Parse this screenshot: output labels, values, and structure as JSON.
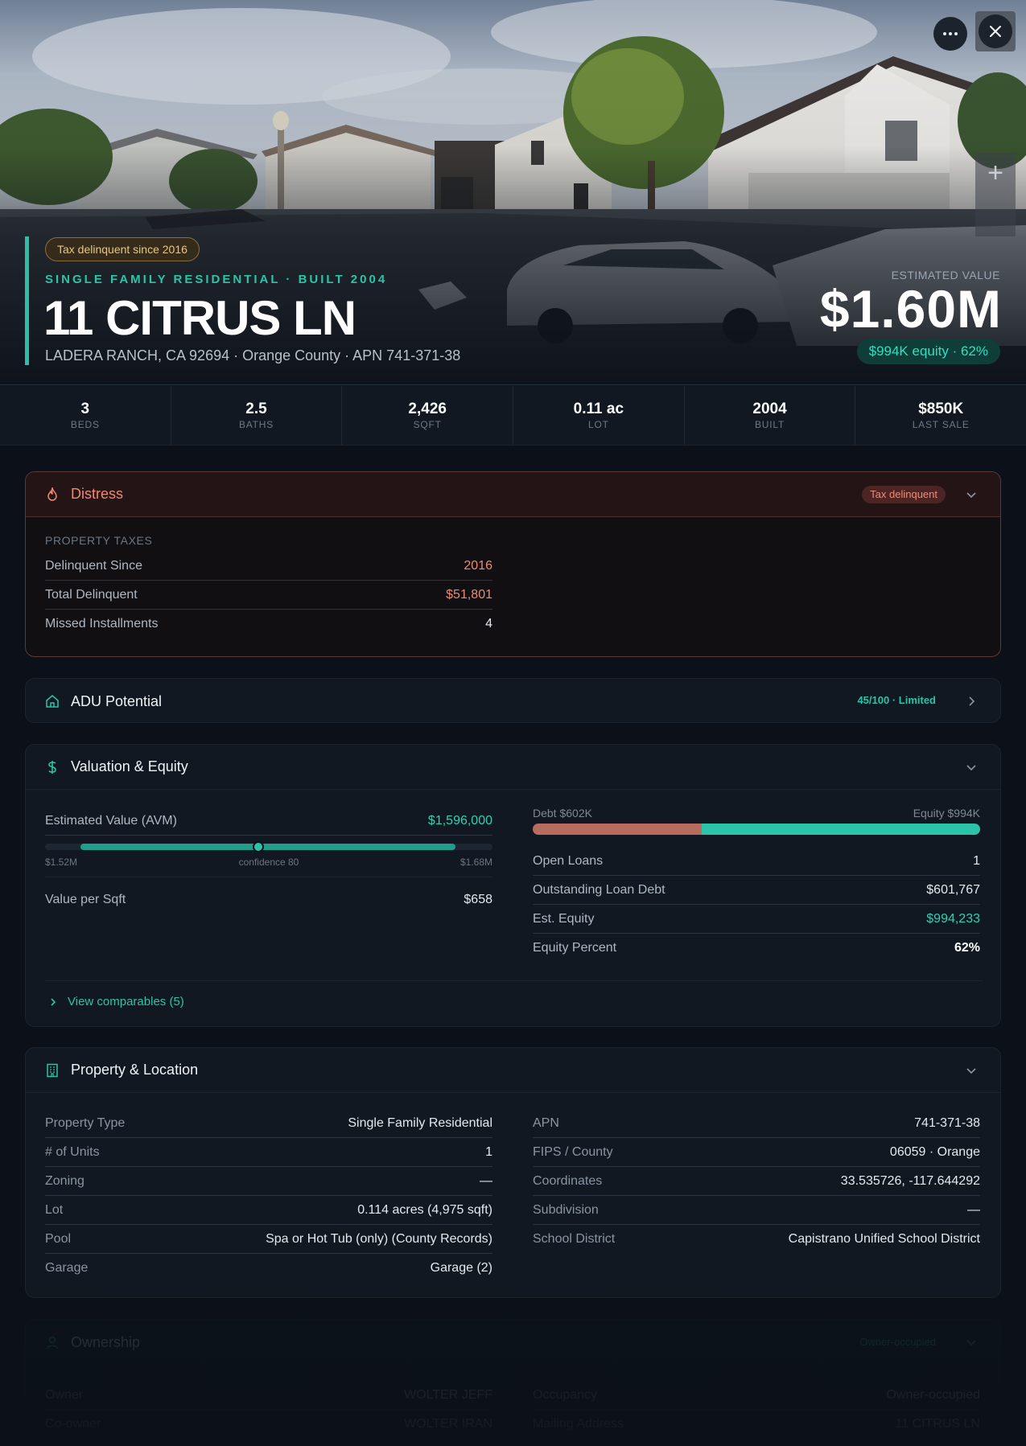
{
  "hero": {
    "tax_pill": "Tax delinquent since 2016",
    "subtitle": "SINGLE FAMILY RESIDENTIAL · BUILT 2004",
    "title": "11 CITRUS LN",
    "address": "LADERA RANCH, CA 92694 · Orange County · APN 741-371-38",
    "estimated_label": "ESTIMATED VALUE",
    "estimated_value": "$1.60M",
    "equity_pill": "$994K equity · 62%",
    "buttons": {
      "more_icon": "more-horizontal-icon",
      "close_icon": "close-icon",
      "zoom_icon": "plus-icon"
    }
  },
  "stats": [
    {
      "value": "3",
      "label": "BEDS"
    },
    {
      "value": "2.5",
      "label": "BATHS"
    },
    {
      "value": "2,426",
      "label": "SQFT"
    },
    {
      "value": "0.11 ac",
      "label": "LOT"
    },
    {
      "value": "2004",
      "label": "BUILT"
    },
    {
      "value": "$850K",
      "label": "LAST SALE"
    }
  ],
  "distress": {
    "title": "Distress",
    "icon": "flame-icon",
    "badge": "Tax delinquent",
    "section_label": "PROPERTY TAXES",
    "rows": [
      {
        "label": "Delinquent Since",
        "value": "2016"
      },
      {
        "label": "Total Delinquent",
        "value": "$51,801"
      },
      {
        "label": "Missed Installments",
        "value": "4"
      }
    ]
  },
  "adu": {
    "title": "ADU Potential",
    "icon": "home-icon",
    "badge": "45/100 · Limited"
  },
  "valuation": {
    "title": "Valuation & Equity",
    "icon": "dollar-icon",
    "avm_label": "Estimated Value (AVM)",
    "avm_value": "$1,596,000",
    "range_low": "$1.52M",
    "range_mid": "confidence 80",
    "range_high": "$1.68M",
    "range_low_num": 1.52,
    "range_high_num": 1.68,
    "avm_num": 1.596,
    "value_per_sqft_label": "Value per Sqft",
    "value_per_sqft": "$658",
    "debt_label": "Debt $602K",
    "equity_label": "Equity $994K",
    "debt_fraction": 0.377,
    "rows": [
      {
        "label": "Open Loans",
        "value": "1"
      },
      {
        "label": "Outstanding Loan Debt",
        "value": "$601,767"
      },
      {
        "label": "Est. Equity",
        "value": "$994,233"
      },
      {
        "label": "Equity Percent",
        "value": "62%"
      }
    ],
    "comparables_link": "View comparables (5)"
  },
  "property": {
    "title": "Property & Location",
    "icon": "building-icon",
    "left_rows": [
      {
        "label": "Property Type",
        "value": "Single Family Residential"
      },
      {
        "label": "# of Units",
        "value": "1"
      },
      {
        "label": "Zoning",
        "value": "—"
      },
      {
        "label": "Lot",
        "value": "0.114 acres (4,975 sqft)"
      },
      {
        "label": "Pool",
        "value": "Spa or Hot Tub (only) (County Records)"
      },
      {
        "label": "Garage",
        "value": "Garage (2)"
      }
    ],
    "right_rows": [
      {
        "label": "APN",
        "value": "741-371-38"
      },
      {
        "label": "FIPS / County",
        "value": "06059 · Orange"
      },
      {
        "label": "Coordinates",
        "value": "33.535726, -117.644292"
      },
      {
        "label": "Subdivision",
        "value": "—"
      },
      {
        "label": "School District",
        "value": "Capistrano Unified School District"
      }
    ]
  },
  "ownership": {
    "title": "Ownership",
    "icon": "user-icon",
    "badge": "Owner-occupied",
    "left_rows": [
      {
        "label": "Owner",
        "value": "WOLTER JEFF"
      },
      {
        "label": "Co-owner",
        "value": "WOLTER IRAN"
      }
    ],
    "right_rows": [
      {
        "label": "Occupancy",
        "value": "Owner-occupied"
      },
      {
        "label": "Mailing Address",
        "value": "11 CITRUS LN"
      }
    ]
  }
}
